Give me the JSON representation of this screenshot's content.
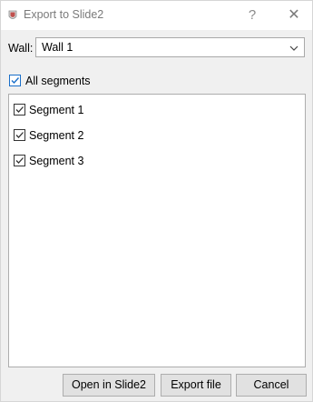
{
  "window": {
    "title": "Export to Slide2",
    "help_glyph": "?",
    "close_glyph": "✕"
  },
  "wall": {
    "label": "Wall:",
    "selected": "Wall 1"
  },
  "all_segments": {
    "label": "All segments",
    "checked": true
  },
  "segments": [
    {
      "label": "Segment 1",
      "checked": true
    },
    {
      "label": "Segment 2",
      "checked": true
    },
    {
      "label": "Segment 3",
      "checked": true
    }
  ],
  "buttons": {
    "open": "Open in Slide2",
    "export": "Export file",
    "cancel": "Cancel"
  },
  "colors": {
    "accent": "#1a6fc9",
    "app_icon": "#c0504d"
  }
}
